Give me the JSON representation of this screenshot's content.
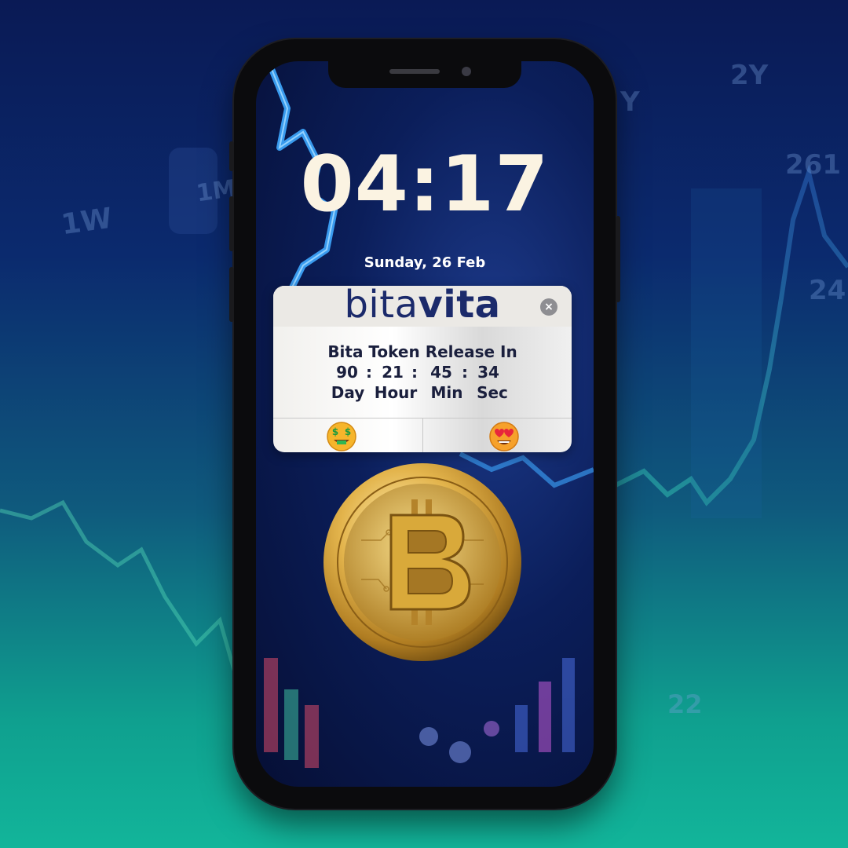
{
  "background": {
    "labels": [
      "1W",
      "1M",
      "Y",
      "2Y",
      "261",
      "24",
      "22"
    ]
  },
  "lockscreen": {
    "time": "04:17",
    "date": "Sunday, 26 Feb"
  },
  "widget": {
    "brand_part1": "bita",
    "brand_part2": "vita",
    "title": "Bita Token Release In",
    "countdown": {
      "day": "90",
      "hour": "21",
      "min": "45",
      "sec": "34",
      "sep": ":"
    },
    "unit_labels": {
      "day": "Day",
      "hour": "Hour",
      "min": "Min",
      "sec": "Sec"
    },
    "actions": [
      "money-mouth-face-icon",
      "heart-eyes-face-icon"
    ]
  },
  "colors": {
    "clock": "#fbf3e2",
    "brand": "#1b2a6b",
    "widget_text": "#1a1f3d",
    "coin_gold": "#d9a93a"
  }
}
